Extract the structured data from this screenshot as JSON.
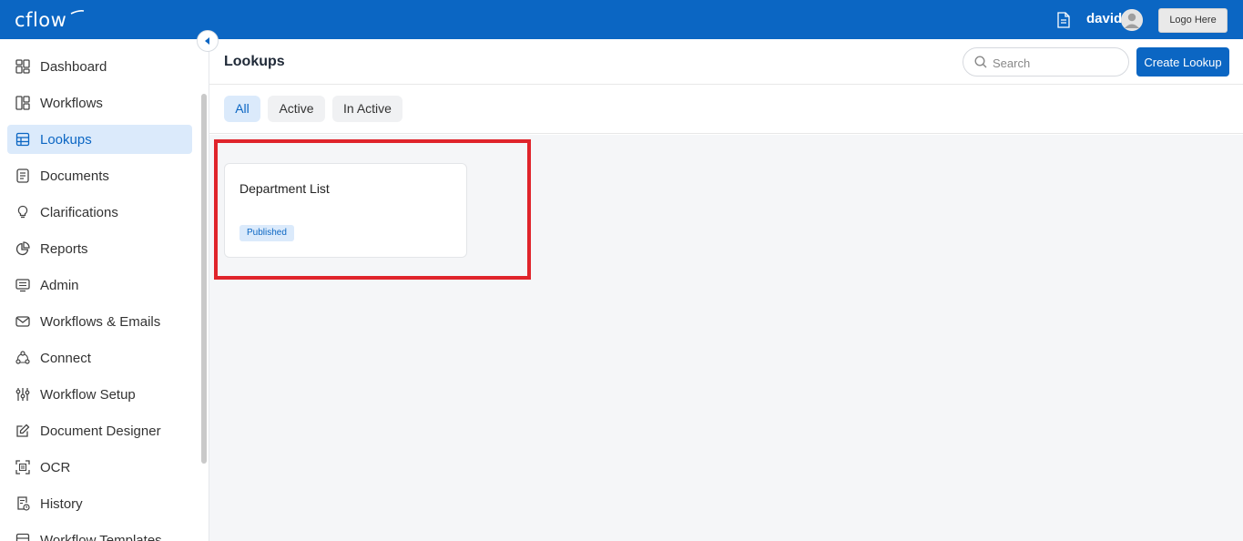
{
  "app": {
    "logo_text": "cflow",
    "username": "david",
    "logo_placeholder_label": "Logo Here"
  },
  "sidebar": {
    "items": [
      {
        "label": "Dashboard",
        "icon": "dashboard-icon"
      },
      {
        "label": "Workflows",
        "icon": "workflows-icon"
      },
      {
        "label": "Lookups",
        "icon": "table-icon",
        "active": true
      },
      {
        "label": "Documents",
        "icon": "document-icon"
      },
      {
        "label": "Clarifications",
        "icon": "lightbulb-icon"
      },
      {
        "label": "Reports",
        "icon": "pie-chart-icon"
      },
      {
        "label": "Admin",
        "icon": "admin-monitor-icon"
      },
      {
        "label": "Workflows & Emails",
        "icon": "mail-icon"
      },
      {
        "label": "Connect",
        "icon": "connect-icon"
      },
      {
        "label": "Workflow Setup",
        "icon": "sliders-icon"
      },
      {
        "label": "Document Designer",
        "icon": "edit-icon"
      },
      {
        "label": "OCR",
        "icon": "ocr-scan-icon"
      },
      {
        "label": "History",
        "icon": "history-icon"
      },
      {
        "label": "Workflow Templates",
        "icon": "template-icon"
      }
    ]
  },
  "header": {
    "title": "Lookups",
    "search_placeholder": "Search",
    "create_label": "Create Lookup"
  },
  "filters": {
    "tabs": [
      {
        "label": "All",
        "active": true
      },
      {
        "label": "Active",
        "active": false
      },
      {
        "label": "In Active",
        "active": false
      }
    ]
  },
  "lookups": [
    {
      "title": "Department List",
      "status": "Published"
    }
  ],
  "colors": {
    "brand": "#0b66c3",
    "active_bg": "#dbeafb",
    "highlight": "#e0242b"
  }
}
